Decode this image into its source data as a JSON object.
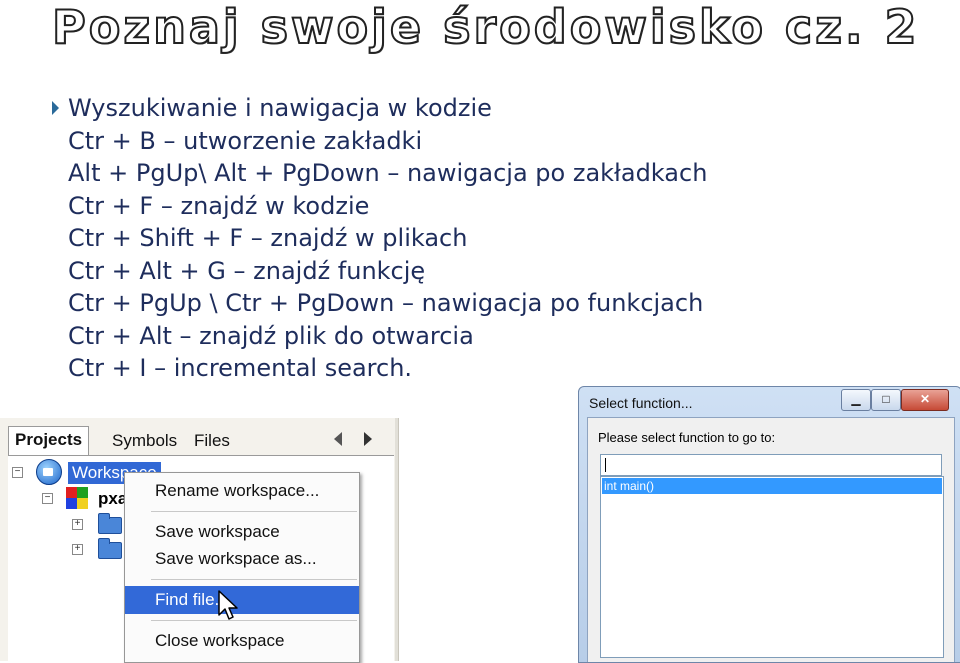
{
  "title": "Poznaj swoje środowisko cz. 2",
  "bullet_heading": "Wyszukiwanie i nawigacja w kodzie",
  "shortcuts": [
    {
      "keys": "Ctr + B",
      "desc": "– utworzenie zakładki"
    },
    {
      "keys": "Alt + PgUp\\ Alt + PgDown",
      "desc": "– nawigacja po zakładkach"
    },
    {
      "keys": "Ctr + F",
      "desc": "– znajdź w kodzie"
    },
    {
      "keys": "Ctr + Shift + F",
      "desc": "– znajdź w plikach"
    },
    {
      "keys": "Ctr + Alt + G",
      "desc": "– znajdź funkcję"
    },
    {
      "keys": "Ctr + PgUp \\ Ctr + PgDown",
      "desc": "– nawigacja po funkcjach"
    },
    {
      "keys": "Ctr + Alt",
      "desc": "– znajdź plik do otwarcia"
    },
    {
      "keys": "Ctr + I",
      "desc": "– incremental search."
    }
  ],
  "ide": {
    "tabs": [
      "Projects",
      "Symbols",
      "Files"
    ],
    "workspace_label": "Workspace",
    "project_label": "pxa",
    "context_menu": {
      "rename": "Rename workspace...",
      "save": "Save workspace",
      "save_as": "Save workspace as...",
      "find_file": "Find file...",
      "close": "Close workspace"
    }
  },
  "dialog": {
    "title": "Select function...",
    "prompt": "Please select function to go to:",
    "input_value": "",
    "list_items": [
      "int main()"
    ]
  },
  "colors": {
    "text": "#1e2d5c",
    "highlight": "#3269d8",
    "list_selection": "#3399ff"
  }
}
